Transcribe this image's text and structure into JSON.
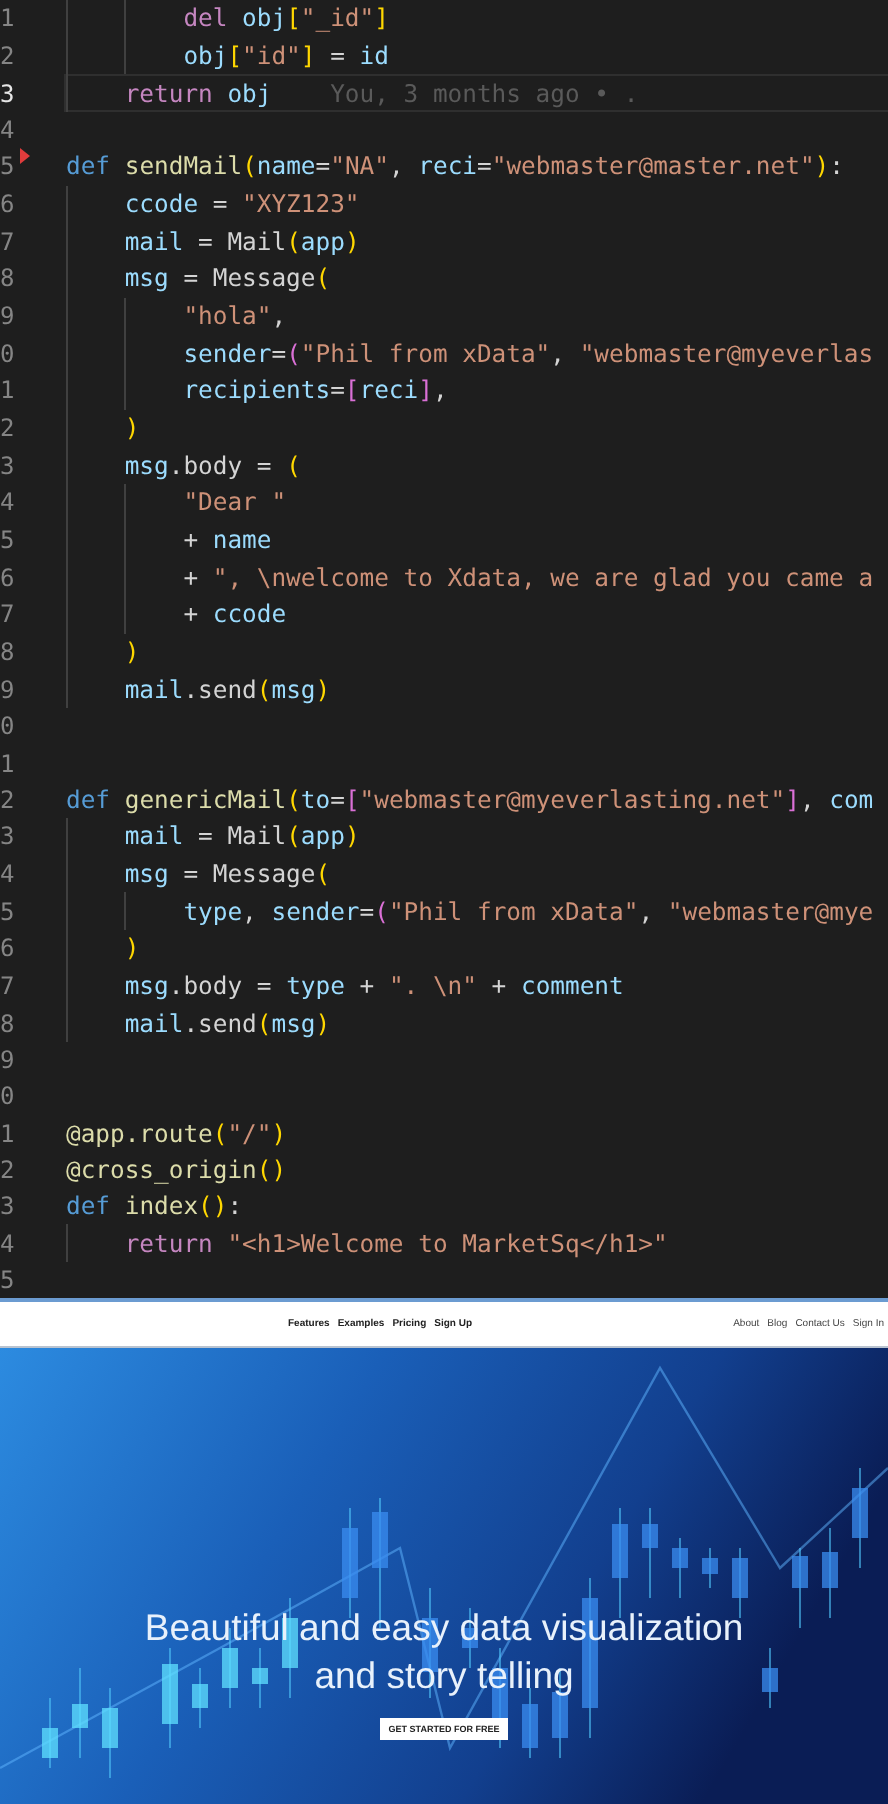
{
  "editor": {
    "lines": [
      {
        "number": "1",
        "current": false,
        "marker": false,
        "tokens": [
          {
            "kind": "guide"
          },
          {
            "kind": "guide"
          },
          {
            "kind": "kw",
            "text": "del "
          },
          {
            "kind": "var",
            "text": "obj"
          },
          {
            "kind": "b1",
            "text": "["
          },
          {
            "kind": "str",
            "text": "\"_id\""
          },
          {
            "kind": "b1",
            "text": "]"
          }
        ]
      },
      {
        "number": "2",
        "current": false,
        "marker": false,
        "tokens": [
          {
            "kind": "guide"
          },
          {
            "kind": "guide"
          },
          {
            "kind": "var",
            "text": "obj"
          },
          {
            "kind": "b1",
            "text": "["
          },
          {
            "kind": "str",
            "text": "\"id\""
          },
          {
            "kind": "b1",
            "text": "]"
          },
          {
            "kind": "plain",
            "text": " = "
          },
          {
            "kind": "var",
            "text": "id"
          }
        ]
      },
      {
        "number": "3",
        "current": true,
        "marker": false,
        "blame": "You, 3 months ago • .",
        "tokens": [
          {
            "kind": "guide"
          },
          {
            "kind": "kw",
            "text": "return "
          },
          {
            "kind": "var",
            "text": "obj"
          }
        ]
      },
      {
        "number": "4",
        "current": false,
        "marker": false
      },
      {
        "number": "5",
        "current": false,
        "marker": true,
        "tokens": [
          {
            "kind": "def",
            "text": "def "
          },
          {
            "kind": "fn",
            "text": "sendMail"
          },
          {
            "kind": "b1",
            "text": "("
          },
          {
            "kind": "var",
            "text": "name"
          },
          {
            "kind": "plain",
            "text": "="
          },
          {
            "kind": "str",
            "text": "\"NA\""
          },
          {
            "kind": "plain",
            "text": ", "
          },
          {
            "kind": "var",
            "text": "reci"
          },
          {
            "kind": "plain",
            "text": "="
          },
          {
            "kind": "str",
            "text": "\"webmaster@master.net\""
          },
          {
            "kind": "b1",
            "text": ")"
          },
          {
            "kind": "plain",
            "text": ":"
          }
        ]
      },
      {
        "number": "6",
        "current": false,
        "marker": false,
        "tokens": [
          {
            "kind": "guide"
          },
          {
            "kind": "var",
            "text": "ccode"
          },
          {
            "kind": "plain",
            "text": " = "
          },
          {
            "kind": "str",
            "text": "\"XYZ123\""
          }
        ]
      },
      {
        "number": "7",
        "current": false,
        "marker": false,
        "tokens": [
          {
            "kind": "guide"
          },
          {
            "kind": "var",
            "text": "mail"
          },
          {
            "kind": "plain",
            "text": " = "
          },
          {
            "kind": "cls",
            "text": "Mail"
          },
          {
            "kind": "b1",
            "text": "("
          },
          {
            "kind": "var",
            "text": "app"
          },
          {
            "kind": "b1",
            "text": ")"
          }
        ]
      },
      {
        "number": "8",
        "current": false,
        "marker": false,
        "tokens": [
          {
            "kind": "guide"
          },
          {
            "kind": "var",
            "text": "msg"
          },
          {
            "kind": "plain",
            "text": " = "
          },
          {
            "kind": "cls",
            "text": "Message"
          },
          {
            "kind": "b1",
            "text": "("
          }
        ]
      },
      {
        "number": "9",
        "current": false,
        "marker": false,
        "tokens": [
          {
            "kind": "guide"
          },
          {
            "kind": "guide"
          },
          {
            "kind": "str",
            "text": "\"hola\""
          },
          {
            "kind": "plain",
            "text": ","
          }
        ]
      },
      {
        "number": "0",
        "current": false,
        "marker": false,
        "tokens": [
          {
            "kind": "guide"
          },
          {
            "kind": "guide"
          },
          {
            "kind": "var",
            "text": "sender"
          },
          {
            "kind": "plain",
            "text": "="
          },
          {
            "kind": "b2",
            "text": "("
          },
          {
            "kind": "str",
            "text": "\"Phil from xData\""
          },
          {
            "kind": "plain",
            "text": ", "
          },
          {
            "kind": "str",
            "text": "\"webmaster@myeverlas"
          }
        ]
      },
      {
        "number": "1",
        "current": false,
        "marker": false,
        "tokens": [
          {
            "kind": "guide"
          },
          {
            "kind": "guide"
          },
          {
            "kind": "var",
            "text": "recipients"
          },
          {
            "kind": "plain",
            "text": "="
          },
          {
            "kind": "b2",
            "text": "["
          },
          {
            "kind": "var",
            "text": "reci"
          },
          {
            "kind": "b2",
            "text": "]"
          },
          {
            "kind": "plain",
            "text": ","
          }
        ]
      },
      {
        "number": "2",
        "current": false,
        "marker": false,
        "tokens": [
          {
            "kind": "guide"
          },
          {
            "kind": "b1",
            "text": ")"
          }
        ]
      },
      {
        "number": "3",
        "current": false,
        "marker": false,
        "tokens": [
          {
            "kind": "guide"
          },
          {
            "kind": "var",
            "text": "msg"
          },
          {
            "kind": "plain",
            "text": ".body = "
          },
          {
            "kind": "b1",
            "text": "("
          }
        ]
      },
      {
        "number": "4",
        "current": false,
        "marker": false,
        "tokens": [
          {
            "kind": "guide"
          },
          {
            "kind": "guide"
          },
          {
            "kind": "str",
            "text": "\"Dear \""
          }
        ]
      },
      {
        "number": "5",
        "current": false,
        "marker": false,
        "tokens": [
          {
            "kind": "guide"
          },
          {
            "kind": "guide"
          },
          {
            "kind": "plain",
            "text": "+ "
          },
          {
            "kind": "var",
            "text": "name"
          }
        ]
      },
      {
        "number": "6",
        "current": false,
        "marker": false,
        "tokens": [
          {
            "kind": "guide"
          },
          {
            "kind": "guide"
          },
          {
            "kind": "plain",
            "text": "+ "
          },
          {
            "kind": "str",
            "text": "\", \\nwelcome to Xdata, we are glad you came a"
          }
        ]
      },
      {
        "number": "7",
        "current": false,
        "marker": false,
        "tokens": [
          {
            "kind": "guide"
          },
          {
            "kind": "guide"
          },
          {
            "kind": "plain",
            "text": "+ "
          },
          {
            "kind": "var",
            "text": "ccode"
          }
        ]
      },
      {
        "number": "8",
        "current": false,
        "marker": false,
        "tokens": [
          {
            "kind": "guide"
          },
          {
            "kind": "b1",
            "text": ")"
          }
        ]
      },
      {
        "number": "9",
        "current": false,
        "marker": false,
        "tokens": [
          {
            "kind": "guide"
          },
          {
            "kind": "var",
            "text": "mail"
          },
          {
            "kind": "plain",
            "text": ".send"
          },
          {
            "kind": "b1",
            "text": "("
          },
          {
            "kind": "var",
            "text": "msg"
          },
          {
            "kind": "b1",
            "text": ")"
          }
        ]
      },
      {
        "number": "0",
        "current": false,
        "marker": false
      },
      {
        "number": "1",
        "current": false,
        "marker": false
      },
      {
        "number": "2",
        "current": false,
        "marker": false,
        "tokens": [
          {
            "kind": "def",
            "text": "def "
          },
          {
            "kind": "fn",
            "text": "genericMail"
          },
          {
            "kind": "b1",
            "text": "("
          },
          {
            "kind": "var",
            "text": "to"
          },
          {
            "kind": "plain",
            "text": "="
          },
          {
            "kind": "b2",
            "text": "["
          },
          {
            "kind": "str",
            "text": "\"webmaster@myeverlasting.net\""
          },
          {
            "kind": "b2",
            "text": "]"
          },
          {
            "kind": "plain",
            "text": ", "
          },
          {
            "kind": "var",
            "text": "com"
          }
        ]
      },
      {
        "number": "3",
        "current": false,
        "marker": false,
        "tokens": [
          {
            "kind": "guide"
          },
          {
            "kind": "var",
            "text": "mail"
          },
          {
            "kind": "plain",
            "text": " = "
          },
          {
            "kind": "cls",
            "text": "Mail"
          },
          {
            "kind": "b1",
            "text": "("
          },
          {
            "kind": "var",
            "text": "app"
          },
          {
            "kind": "b1",
            "text": ")"
          }
        ]
      },
      {
        "number": "4",
        "current": false,
        "marker": false,
        "tokens": [
          {
            "kind": "guide"
          },
          {
            "kind": "var",
            "text": "msg"
          },
          {
            "kind": "plain",
            "text": " = "
          },
          {
            "kind": "cls",
            "text": "Message"
          },
          {
            "kind": "b1",
            "text": "("
          }
        ]
      },
      {
        "number": "5",
        "current": false,
        "marker": false,
        "tokens": [
          {
            "kind": "guide"
          },
          {
            "kind": "guide"
          },
          {
            "kind": "var",
            "text": "type"
          },
          {
            "kind": "plain",
            "text": ", "
          },
          {
            "kind": "var",
            "text": "sender"
          },
          {
            "kind": "plain",
            "text": "="
          },
          {
            "kind": "b2",
            "text": "("
          },
          {
            "kind": "str",
            "text": "\"Phil from xData\""
          },
          {
            "kind": "plain",
            "text": ", "
          },
          {
            "kind": "str",
            "text": "\"webmaster@mye"
          }
        ]
      },
      {
        "number": "6",
        "current": false,
        "marker": false,
        "tokens": [
          {
            "kind": "guide"
          },
          {
            "kind": "b1",
            "text": ")"
          }
        ]
      },
      {
        "number": "7",
        "current": false,
        "marker": false,
        "tokens": [
          {
            "kind": "guide"
          },
          {
            "kind": "var",
            "text": "msg"
          },
          {
            "kind": "plain",
            "text": ".body = "
          },
          {
            "kind": "var",
            "text": "type"
          },
          {
            "kind": "plain",
            "text": " + "
          },
          {
            "kind": "str",
            "text": "\". \\n\""
          },
          {
            "kind": "plain",
            "text": " + "
          },
          {
            "kind": "var",
            "text": "comment"
          }
        ]
      },
      {
        "number": "8",
        "current": false,
        "marker": false,
        "tokens": [
          {
            "kind": "guide"
          },
          {
            "kind": "var",
            "text": "mail"
          },
          {
            "kind": "plain",
            "text": ".send"
          },
          {
            "kind": "b1",
            "text": "("
          },
          {
            "kind": "var",
            "text": "msg"
          },
          {
            "kind": "b1",
            "text": ")"
          }
        ]
      },
      {
        "number": "9",
        "current": false,
        "marker": false
      },
      {
        "number": "0",
        "current": false,
        "marker": false
      },
      {
        "number": "1",
        "current": false,
        "marker": false,
        "tokens": [
          {
            "kind": "fn",
            "text": "@app.route"
          },
          {
            "kind": "b1",
            "text": "("
          },
          {
            "kind": "str",
            "text": "\"/\""
          },
          {
            "kind": "b1",
            "text": ")"
          }
        ]
      },
      {
        "number": "2",
        "current": false,
        "marker": false,
        "tokens": [
          {
            "kind": "fn",
            "text": "@cross_origin"
          },
          {
            "kind": "b1",
            "text": "()"
          }
        ]
      },
      {
        "number": "3",
        "current": false,
        "marker": false,
        "tokens": [
          {
            "kind": "def",
            "text": "def "
          },
          {
            "kind": "fn",
            "text": "index"
          },
          {
            "kind": "b1",
            "text": "()"
          },
          {
            "kind": "plain",
            "text": ":"
          }
        ]
      },
      {
        "number": "4",
        "current": false,
        "marker": false,
        "tokens": [
          {
            "kind": "guide"
          },
          {
            "kind": "kw",
            "text": "return "
          },
          {
            "kind": "str",
            "text": "\"<h1>Welcome to MarketSq</h1>\""
          }
        ]
      },
      {
        "number": "5",
        "current": false,
        "marker": false
      }
    ]
  },
  "website": {
    "nav_center": [
      "Features",
      "Examples",
      "Pricing",
      "Sign Up"
    ],
    "nav_right": [
      "About",
      "Blog",
      "Contact Us",
      "Sign In"
    ],
    "headline": "Beautiful and easy data visualization and story telling",
    "cta_button": "GET STARTED FOR FREE"
  }
}
